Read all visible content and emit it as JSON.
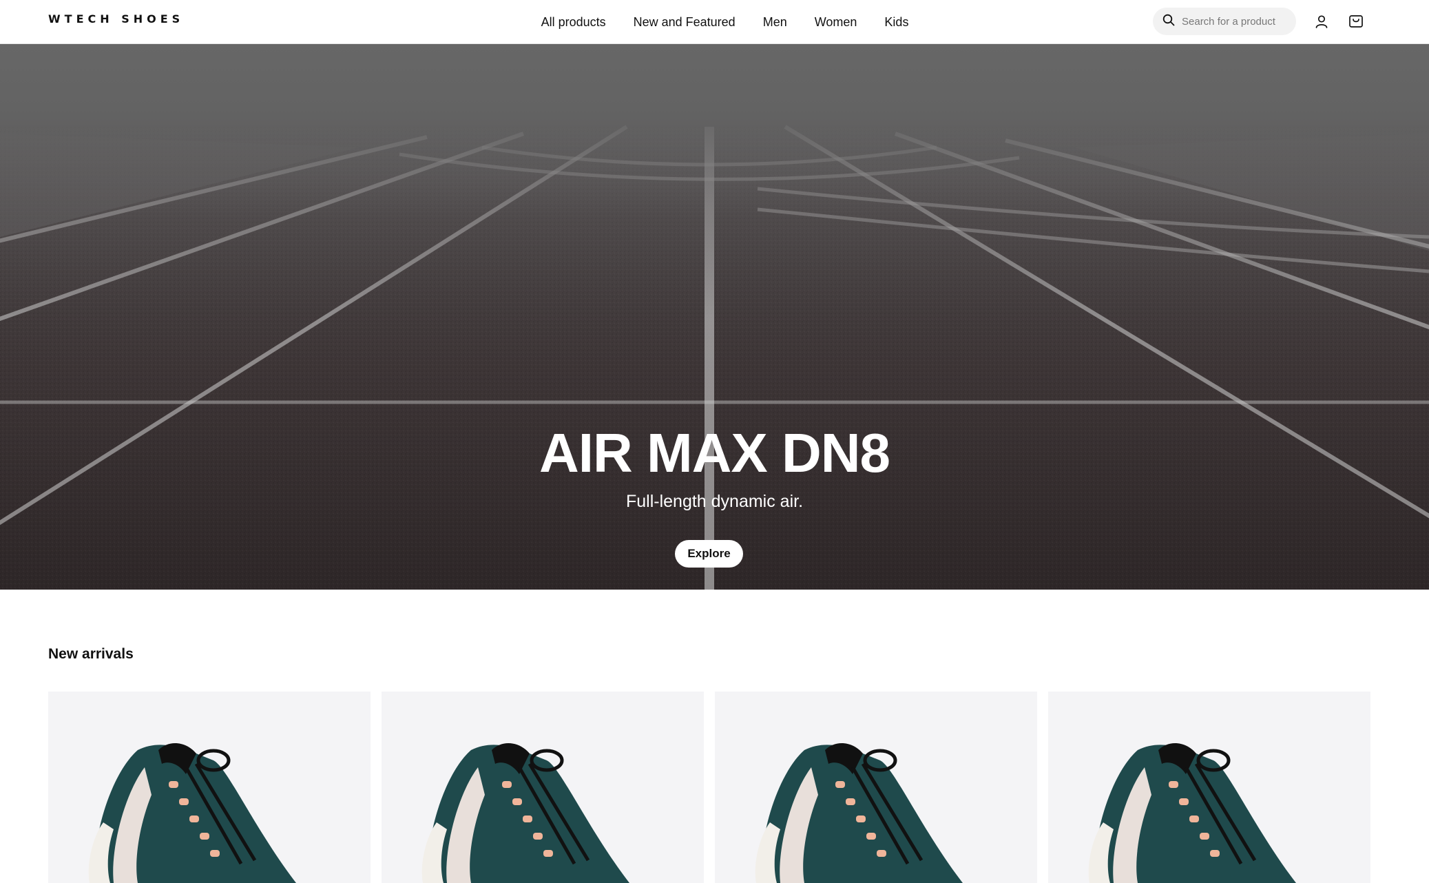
{
  "header": {
    "logo": "WTECH SHOES",
    "nav": [
      {
        "label": "All products"
      },
      {
        "label": "New and Featured"
      },
      {
        "label": "Men"
      },
      {
        "label": "Women"
      },
      {
        "label": "Kids"
      }
    ],
    "search": {
      "placeholder": "Search for a product",
      "icon": "search-icon"
    },
    "icons": [
      "user-icon",
      "cart-icon"
    ]
  },
  "hero": {
    "title": "AIR MAX DN8",
    "subtitle": "Full-length dynamic air.",
    "cta_label": "Explore"
  },
  "new_arrivals": {
    "title": "New arrivals",
    "products": [
      {
        "image": "sneaker-image"
      },
      {
        "image": "sneaker-image"
      },
      {
        "image": "sneaker-image"
      },
      {
        "image": "sneaker-image"
      }
    ]
  }
}
